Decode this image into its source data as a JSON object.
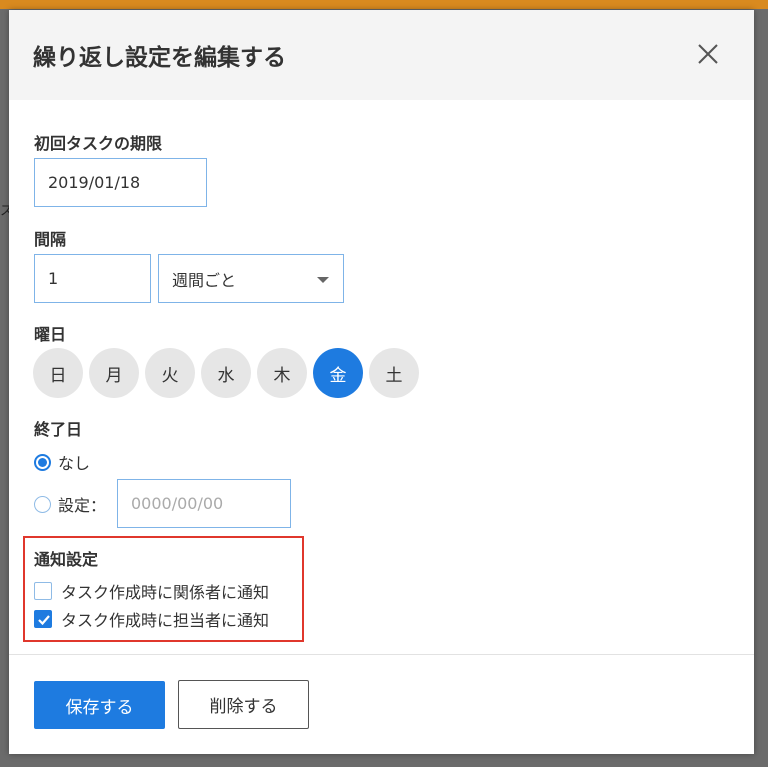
{
  "modal": {
    "title": "繰り返し設定を編集する",
    "close_icon": "close-icon"
  },
  "first_due": {
    "label": "初回タスクの期限",
    "value": "2019/01/18"
  },
  "interval": {
    "label": "間隔",
    "value": "1",
    "unit_selected": "週間ごと"
  },
  "weekday": {
    "label": "曜日",
    "days": [
      "日",
      "月",
      "火",
      "水",
      "木",
      "金",
      "土"
    ],
    "selected": "金"
  },
  "end_date": {
    "label": "終了日",
    "option_none": "なし",
    "option_set": "設定：",
    "date_placeholder": "0000/00/00",
    "selected": "none"
  },
  "notification": {
    "label": "通知設定",
    "notify_stakeholders": "タスク作成時に関係者に通知",
    "notify_stakeholders_checked": false,
    "notify_assignee": "タスク作成時に担当者に通知",
    "notify_assignee_checked": true,
    "highlight_color": "#e0372c"
  },
  "footer": {
    "save_label": "保存する",
    "delete_label": "削除する"
  },
  "colors": {
    "accent": "#1e7be0",
    "header_bg": "#f4f4f4",
    "top_bar": "#d98a1f"
  },
  "background": {
    "partial_char": "ス"
  }
}
